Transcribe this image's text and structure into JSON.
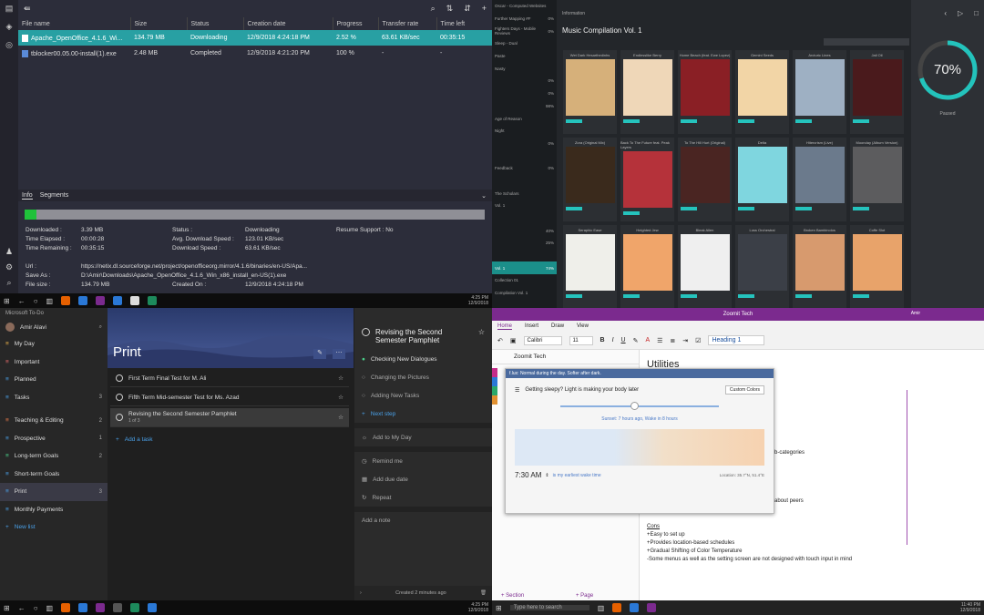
{
  "dl": {
    "columns": [
      "File name",
      "Size",
      "Status",
      "Creation date",
      "Progress",
      "Transfer rate",
      "Time left"
    ],
    "rows": [
      {
        "name": "Apache_OpenOffice_4.1.6_Wi...",
        "size": "134.79 MB",
        "status": "Downloading",
        "date": "12/9/2018 4:24:18 PM",
        "progress": "2.52 %",
        "rate": "63.61 KB/sec",
        "left": "00:35:15"
      },
      {
        "name": "tblocker00.05.00-install(1).exe",
        "size": "2.48 MB",
        "status": "Completed",
        "date": "12/9/2018 4:21:20 PM",
        "progress": "100 %",
        "rate": "-",
        "left": "-"
      }
    ],
    "tabs": [
      "Info",
      "Segments"
    ],
    "progress_fraction": 0.025,
    "info": {
      "downloaded_l": "Downloaded :",
      "downloaded": "3.39 MB",
      "elapsed_l": "Time Elapsed :",
      "elapsed": "00:00:28",
      "remaining_l": "Time Remaining :",
      "remaining": "00:35:15",
      "status_l": "Status :",
      "status": "Downloading",
      "avg_l": "Avg. Download Speed :",
      "avg": "123.01 KB/sec",
      "speed_l": "Download Speed :",
      "speed": "63.61 KB/sec",
      "resume_l": "Resume Support :",
      "resume": "No",
      "url_l": "Url :",
      "url": "https://netix.dl.sourceforge.net/project/openofficeorg.mirror/4.1.6/binaries/en-US/Apa...",
      "save_l": "Save As :",
      "save": "D:\\Amir\\Downloads\\Apache_OpenOffice_4.1.6_Win_x86_install_en-US(1).exe",
      "fsize_l": "File size :",
      "fsize": "134.79 MB",
      "created_l": "Created On :",
      "created": "12/9/2018 4:24:18 PM"
    },
    "clock": "4:25 PM\n12/9/2018"
  },
  "music": {
    "header": "Information",
    "album": "Music Compilation Vol. 1",
    "list": [
      {
        "t": "Oscar - Computed Websites",
        "n": ""
      },
      {
        "t": "Further Mapping #F",
        "n": "0%"
      },
      {
        "t": "Fighters Days - Mobile Reviews",
        "n": "0%"
      },
      {
        "t": "Sleep - Dual",
        "n": ""
      },
      {
        "t": "Paste",
        "n": ""
      },
      {
        "t": "Nasty",
        "n": ""
      },
      {
        "t": "",
        "n": "0%"
      },
      {
        "t": "",
        "n": "0%"
      },
      {
        "t": "",
        "n": "98%"
      },
      {
        "t": "Age of Reason",
        "n": ""
      },
      {
        "t": "Night",
        "n": ""
      },
      {
        "t": "",
        "n": "0%"
      },
      {
        "t": "",
        "n": ""
      },
      {
        "t": "Feedback",
        "n": "0%"
      },
      {
        "t": "",
        "n": ""
      },
      {
        "t": "The Scholars",
        "n": ""
      },
      {
        "t": "Vol. 1",
        "n": ""
      },
      {
        "t": "",
        "n": ""
      },
      {
        "t": "",
        "n": "40%"
      },
      {
        "t": "",
        "n": "25%"
      },
      {
        "t": "",
        "n": ""
      },
      {
        "t": "Vol. 1",
        "n": "74%"
      },
      {
        "t": "Collection 01",
        "n": ""
      },
      {
        "t": "Compilation Vol. 1",
        "n": ""
      }
    ],
    "cards": [
      {
        "t": "Wet Dark Hesarthedinhs",
        "c": "#d6b07a"
      },
      {
        "t": "Endlesslike Berry",
        "c": "#efd7b8"
      },
      {
        "t": "Home Beach (feat. Ewe Lopez)",
        "c": "#8a1f25"
      },
      {
        "t": "Gemini Seeds",
        "c": "#f2d5a6"
      },
      {
        "t": "Arcturic Lines",
        "c": "#9eb0c3"
      },
      {
        "t": "Jail Oil",
        "c": "#4a1a1c"
      },
      {
        "t": "Zora (Original Mix)",
        "c": "#3a2a1c"
      },
      {
        "t": "Back To The Future feat. Peak Layers",
        "c": "#b5323a"
      },
      {
        "t": "To The Hill Hurt (Original)",
        "c": "#4a2522"
      },
      {
        "t": "Delta",
        "c": "#7fd6df"
      },
      {
        "t": "Hitercrism (Live)",
        "c": "#6b7a8c"
      },
      {
        "t": "Moonday (Album Version)",
        "c": "#5c5c5e"
      },
      {
        "t": "Seraphic Ease",
        "c": "#efefea"
      },
      {
        "t": "Heighted Jew",
        "c": "#f0a56a"
      },
      {
        "t": "Bleak Allen",
        "c": "#efefef"
      },
      {
        "t": "Loss Orchestral",
        "c": "#3b3f47"
      },
      {
        "t": "Broken Bambinolos",
        "c": "#d79a6e"
      },
      {
        "t": "Coffe Slot",
        "c": "#e8a36a"
      }
    ],
    "ring": "70%",
    "ring_fraction": 0.7,
    "ring_label": "Paused"
  },
  "todo": {
    "app": "Microsoft To-Do",
    "user": "Amir Alavi",
    "nav": [
      {
        "l": "My Day",
        "c": "",
        "color": "#e8b04a"
      },
      {
        "l": "Important",
        "c": "",
        "color": "#e06868"
      },
      {
        "l": "Planned",
        "c": "",
        "color": "#4aa0e8"
      },
      {
        "l": "Tasks",
        "c": "3",
        "color": "#4aa0e8"
      },
      {
        "l": "Teaching & Editing",
        "c": "2",
        "color": "#e87a4a"
      },
      {
        "l": "Prospective",
        "c": "1",
        "color": "#4aa0e8"
      },
      {
        "l": "Long-term Goals",
        "c": "2",
        "color": "#4ad08a"
      },
      {
        "l": "Short-term Goals",
        "c": "",
        "color": "#4aa0e8"
      },
      {
        "l": "Print",
        "c": "3",
        "color": "#4aa0e8"
      },
      {
        "l": "Monthly Payments",
        "c": "",
        "color": "#4aa0e8"
      }
    ],
    "new_list": "New list",
    "list_title": "Print",
    "tasks": [
      {
        "t": "First Term Final Test for M. Ali",
        "s": ""
      },
      {
        "t": "Fifth Term Mid-semester Test for Ms. Azad",
        "s": ""
      },
      {
        "t": "Revising the Second Semester Pamphlet",
        "s": "1 of 3"
      }
    ],
    "add_task": "Add a task",
    "detail_title": "Revising the Second Semester Pamphlet",
    "steps": [
      "Checking New Dialogues",
      "Changing the Pictures",
      "Adding New Tasks"
    ],
    "next_step": "Next step",
    "actions": [
      "Add to My Day",
      "Remind me",
      "Add due date",
      "Repeat"
    ],
    "add_note": "Add a note",
    "created": "Created 2 minutes ago",
    "clock": "4:25 PM\n12/9/2018"
  },
  "onenote": {
    "title": "Zoomit Tech",
    "user": "Amir",
    "tabs": [
      "Home",
      "Insert",
      "Draw",
      "View"
    ],
    "font": "Calibri",
    "size": "11",
    "style": "Heading 1",
    "notebook": "Zoomit Tech",
    "heading": "Utilities",
    "dialog_title": "f.lux: Normal during the day. Softer after dark.",
    "dialog_msg": "Getting sleepy? Light is making your body later",
    "dialog_preset": "Custom Colors",
    "sunset": "Sunset: 7 hours ago, Wake in 8 hours",
    "wake": "7:30 AM",
    "wake_note": "is my earliest wake time",
    "location": "Location: 35.7°N, 51.4°E",
    "bullets": [
      "Easy to set up",
      "Provides location-based schedules",
      "Gradual Shifting of Color Temperature",
      "Some menus as well as the setting screen are not designed with touch input in mind"
    ],
    "cons": "Cons",
    "frag1": "b-categories",
    "frag2": "about peers",
    "section": "+ Section",
    "page": "+ Page",
    "search": "Type here to search",
    "clock": "11:40 PM\n12/9/2018"
  }
}
